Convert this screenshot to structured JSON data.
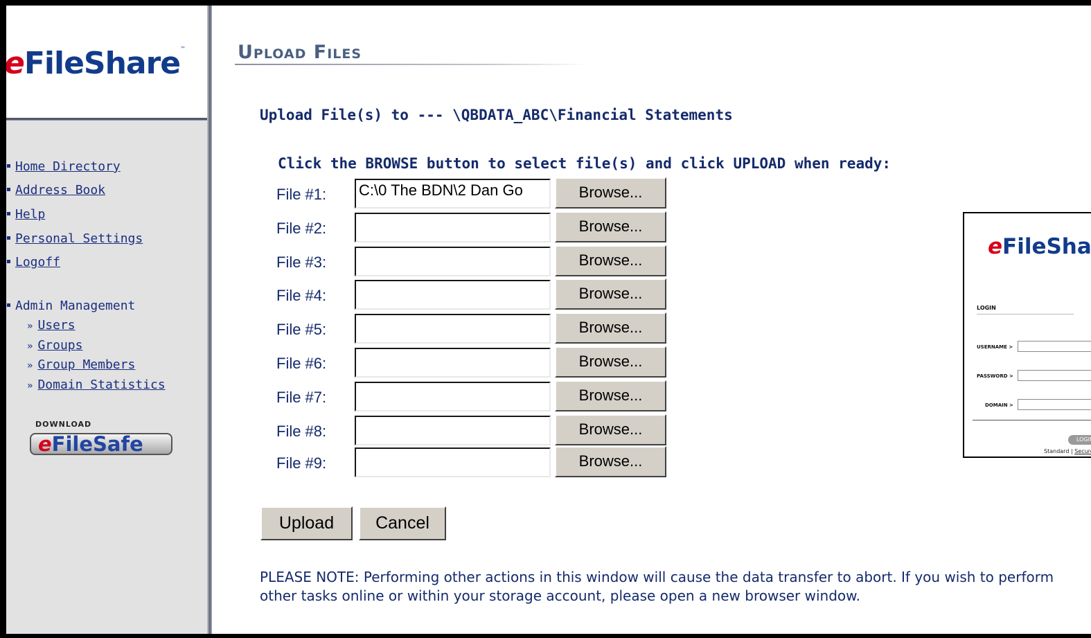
{
  "sidebar": {
    "logo_e": "e",
    "logo_text": "FileShare",
    "logo_tm": "™",
    "nav": [
      {
        "label": "Home Directory"
      },
      {
        "label": "Address Book"
      },
      {
        "label": "Help"
      },
      {
        "label": "Personal Settings"
      },
      {
        "label": "Logoff"
      }
    ],
    "admin_label": "Admin Management",
    "admin_items": [
      {
        "label": "Users"
      },
      {
        "label": "Groups"
      },
      {
        "label": "Group Members"
      },
      {
        "label": "Domain Statistics"
      }
    ],
    "download_label": "DOWNLOAD",
    "download_e": "e",
    "download_text": "FileSafe"
  },
  "main": {
    "title": "Upload Files",
    "upload_to": "Upload File(s) to --- \\QBDATA_ABC\\Financial Statements",
    "instructions": "Click the BROWSE button to select file(s) and click UPLOAD when ready:",
    "browse_label": "Browse...",
    "files": [
      {
        "label": "File #1:",
        "value": "C:\\0 The BDN\\2 Dan Go"
      },
      {
        "label": "File #2:",
        "value": ""
      },
      {
        "label": "File #3:",
        "value": ""
      },
      {
        "label": "File #4:",
        "value": ""
      },
      {
        "label": "File #5:",
        "value": ""
      },
      {
        "label": "File #6:",
        "value": ""
      },
      {
        "label": "File #7:",
        "value": ""
      },
      {
        "label": "File #8:",
        "value": ""
      },
      {
        "label": "File #9:",
        "value": ""
      }
    ],
    "upload_label": "Upload",
    "cancel_label": "Cancel",
    "note": "PLEASE NOTE: Performing other actions in this window will cause the data transfer to abort. If you wish to perform other tasks online or within your storage account, please open a new browser window."
  },
  "login_thumb": {
    "logo_e": "e",
    "logo_text": "FileShare",
    "heading": "LOGIN",
    "username_label": "USERNAME >",
    "password_label": "PASSWORD >",
    "domain_label": "DOMAIN >",
    "button_label": "LOGIN",
    "footer_standard": "Standard",
    "footer_sep": " | ",
    "footer_secure": "Secure"
  }
}
